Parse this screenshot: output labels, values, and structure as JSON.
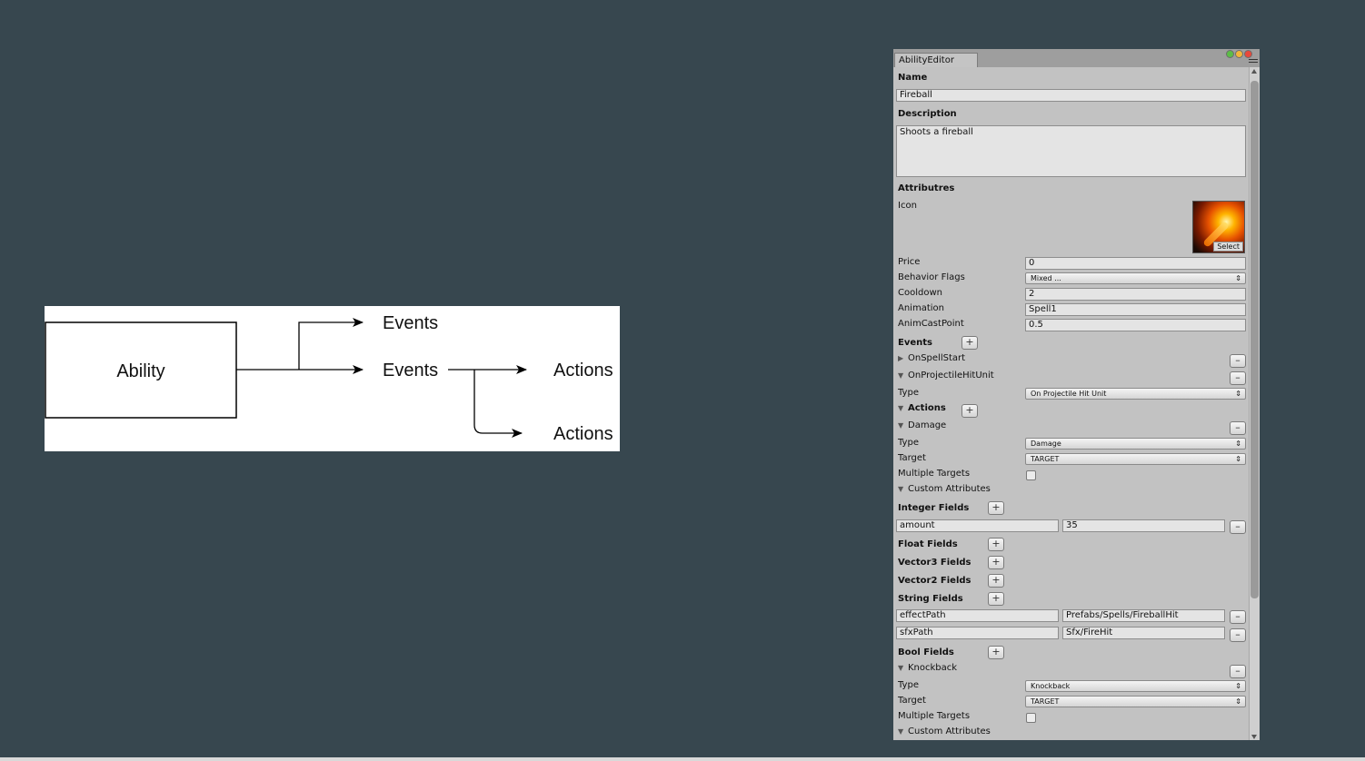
{
  "diagram": {
    "ability_label": "Ability",
    "events_top": "Events",
    "events_mid": "Events",
    "actions_top": "Actions",
    "actions_bottom": "Actions"
  },
  "editor": {
    "tab_title": "AbilityEditor",
    "name_heading": "Name",
    "name_value": "Fireball",
    "description_heading": "Description",
    "description_value": "Shoots a fireball",
    "attributes_heading": "Attributres",
    "icon_label": "Icon",
    "icon_select": "Select",
    "price_label": "Price",
    "price_value": "0",
    "behavior_label": "Behavior Flags",
    "behavior_value": "Mixed ...",
    "cooldown_label": "Cooldown",
    "cooldown_value": "2",
    "animation_label": "Animation",
    "animation_value": "Spell1",
    "animcast_label": "AnimCastPoint",
    "animcast_value": "0.5",
    "events_heading": "Events",
    "plus": "+",
    "minus": "–",
    "dropdown_arrow": "⇕",
    "event1_label": "OnSpellStart",
    "event2_label": "OnProjectileHitUnit",
    "type_label": "Type",
    "event2_type_value": "On Projectile Hit Unit",
    "actions_heading": "Actions",
    "damage_label": "Damage",
    "damage_type_value": "Damage",
    "target_label": "Target",
    "target_value": "TARGET",
    "multiple_targets_label": "Multiple Targets",
    "custom_attributes_label": "Custom Attributes",
    "integer_fields": "Integer Fields",
    "int_key": "amount",
    "int_value": "35",
    "float_fields": "Float Fields",
    "vector3_fields": "Vector3 Fields",
    "vector2_fields": "Vector2 Fields",
    "string_fields": "String Fields",
    "str1_key": "effectPath",
    "str1_value": "Prefabs/Spells/FireballHit",
    "str2_key": "sfxPath",
    "str2_value": "Sfx/FireHit",
    "bool_fields": "Bool Fields",
    "knockback_label": "Knockback",
    "knockback_type_value": "Knockback",
    "knockback_target_value": "TARGET"
  },
  "colors": {
    "page_bg": "#37474f",
    "editor_bg": "#c2c2c2",
    "close": "#e8483b",
    "minimize": "#f2b53a",
    "maximize": "#5cbd46"
  },
  "icons": {
    "foldout_open": "▼",
    "foldout_closed": "▶"
  }
}
